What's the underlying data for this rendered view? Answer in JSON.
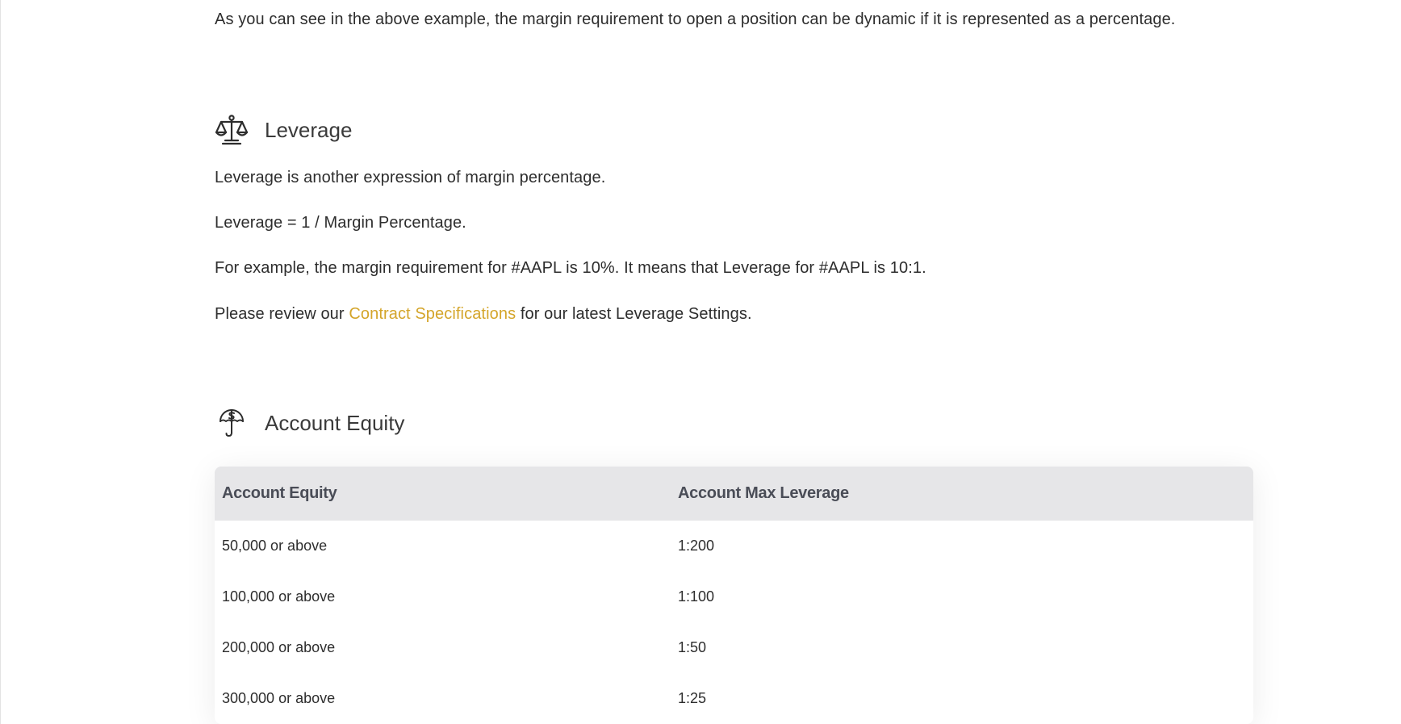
{
  "intro_text": "As you can see in the above example, the margin requirement to open a position can be dynamic if it is represented as a percentage.",
  "leverage": {
    "title": "Leverage",
    "icon": "scales-icon",
    "para1": "Leverage is another expression of margin percentage.",
    "para2": "Leverage = 1 / Margin Percentage.",
    "para3": "For example, the margin requirement for #AAPL is 10%. It means that Leverage for #AAPL is 10:1.",
    "para4_before": "Please review our ",
    "para4_link": "Contract Specifications",
    "para4_after": " for our latest Leverage Settings."
  },
  "account_equity": {
    "title": "Account Equity",
    "icon": "money-umbrella-icon",
    "table": {
      "headers": [
        "Account Equity",
        "Account Max Leverage"
      ],
      "rows": [
        [
          "50,000 or above",
          "1:200"
        ],
        [
          "100,000 or above",
          "1:100"
        ],
        [
          "200,000 or above",
          "1:50"
        ],
        [
          "300,000 or above",
          "1:25"
        ]
      ]
    }
  },
  "colors": {
    "link": "#d4a52a",
    "table_header_bg": "#e6e6e8",
    "text": "#2d2d2d"
  }
}
